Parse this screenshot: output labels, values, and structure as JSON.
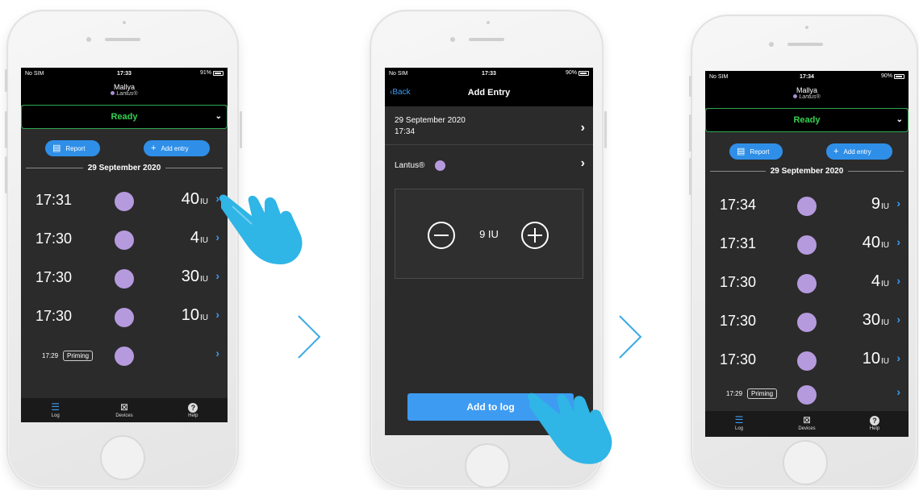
{
  "colors": {
    "accent": "#2f8fe8",
    "ready_green": "#35d04f",
    "dose_dot": "#b69ade",
    "hand": "#2fb5e6"
  },
  "status": {
    "carrier": "No SIM",
    "screen1_time": "17:33",
    "screen1_batt": "91%",
    "screen2_time": "17:33",
    "screen2_batt": "90%",
    "screen3_time": "17:34",
    "screen3_batt": "90%"
  },
  "device": {
    "name": "Mallya",
    "insulin": "Lantus®"
  },
  "ready_label": "Ready",
  "buttons": {
    "report": "Report",
    "add_entry": "Add entry",
    "add_to_log": "Add to log",
    "back": "Back"
  },
  "log1": {
    "date": "29 September 2020",
    "entries": [
      {
        "time": "17:31",
        "dose": "40",
        "unit": "IU"
      },
      {
        "time": "17:30",
        "dose": "4",
        "unit": "IU"
      },
      {
        "time": "17:30",
        "dose": "30",
        "unit": "IU"
      },
      {
        "time": "17:30",
        "dose": "10",
        "unit": "IU"
      }
    ],
    "priming": {
      "time": "17:29",
      "label": "Priming"
    }
  },
  "add_entry_screen": {
    "title": "Add Entry",
    "date": "29 September 2020",
    "time": "17:34",
    "insulin": "Lantus®",
    "dose_value": "9 IU"
  },
  "log3": {
    "date": "29 September 2020",
    "entries": [
      {
        "time": "17:34",
        "dose": "9",
        "unit": "IU"
      },
      {
        "time": "17:31",
        "dose": "40",
        "unit": "IU"
      },
      {
        "time": "17:30",
        "dose": "4",
        "unit": "IU"
      },
      {
        "time": "17:30",
        "dose": "30",
        "unit": "IU"
      },
      {
        "time": "17:30",
        "dose": "10",
        "unit": "IU"
      }
    ],
    "priming": {
      "time": "17:29",
      "label": "Priming"
    }
  },
  "tabs": [
    {
      "label": "Log",
      "icon": "list-icon"
    },
    {
      "label": "Devices",
      "icon": "devices-icon"
    },
    {
      "label": "Help",
      "icon": "help-icon"
    }
  ]
}
